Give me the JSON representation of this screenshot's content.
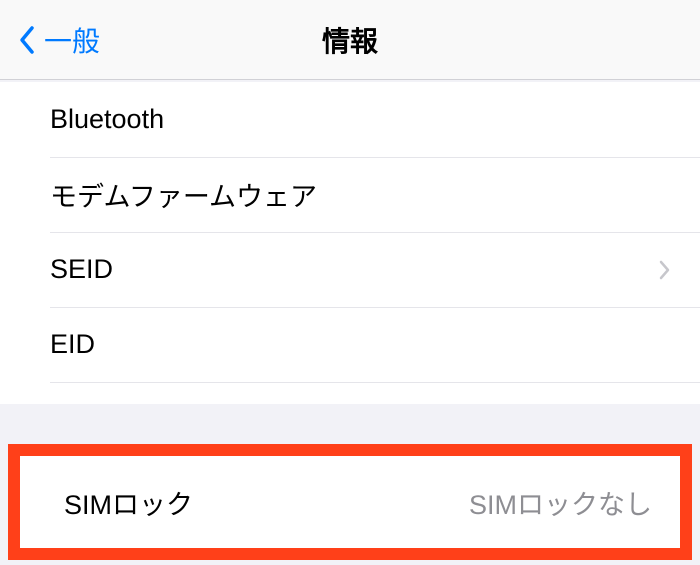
{
  "nav": {
    "back_label": "一般",
    "title": "情報"
  },
  "section1": {
    "items": [
      {
        "label": "Bluetooth",
        "value": "",
        "hasChevron": false
      },
      {
        "label": "モデムファームウェア",
        "value": "",
        "hasChevron": false
      },
      {
        "label": "SEID",
        "value": "",
        "hasChevron": true
      },
      {
        "label": "EID",
        "value": "",
        "hasChevron": false
      }
    ]
  },
  "section2": {
    "sim_lock": {
      "label": "SIMロック",
      "value": "SIMロックなし"
    }
  }
}
